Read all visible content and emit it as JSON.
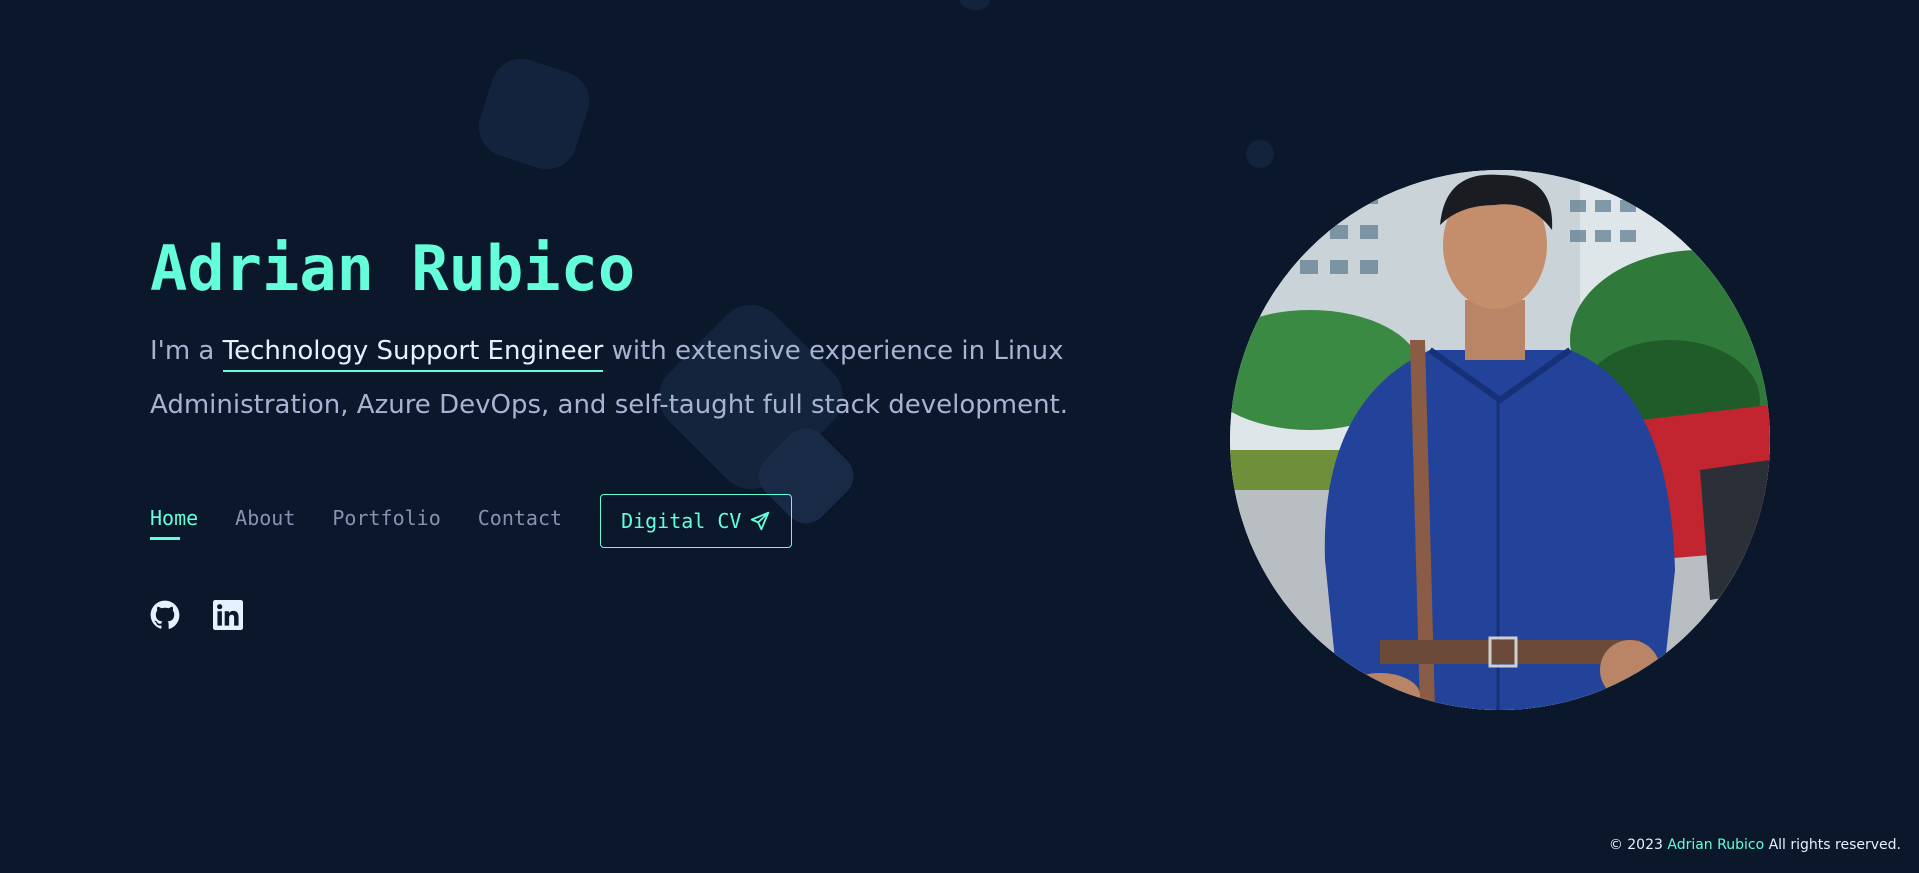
{
  "hero": {
    "name": "Adrian Rubico",
    "intro_prefix": "I'm a ",
    "role": "Technology Support Engineer",
    "intro_suffix": " with extensive experience in Linux Administration, Azure DevOps, and self-taught full stack development."
  },
  "nav": {
    "items": [
      {
        "label": "Home",
        "active": true
      },
      {
        "label": "About",
        "active": false
      },
      {
        "label": "Portfolio",
        "active": false
      },
      {
        "label": "Contact",
        "active": false
      }
    ],
    "cv_button": "Digital CV",
    "cv_icon": "paper-plane-icon"
  },
  "socials": [
    {
      "icon": "github-icon"
    },
    {
      "icon": "linkedin-icon"
    }
  ],
  "footer": {
    "prefix": "© 2023",
    "name": "Adrian Rubico",
    "suffix": "All rights reserved."
  },
  "colors": {
    "background": "#0b172a",
    "accent": "#64ffda",
    "text": "#a8b2d1",
    "heading": "#e6f1ff"
  }
}
